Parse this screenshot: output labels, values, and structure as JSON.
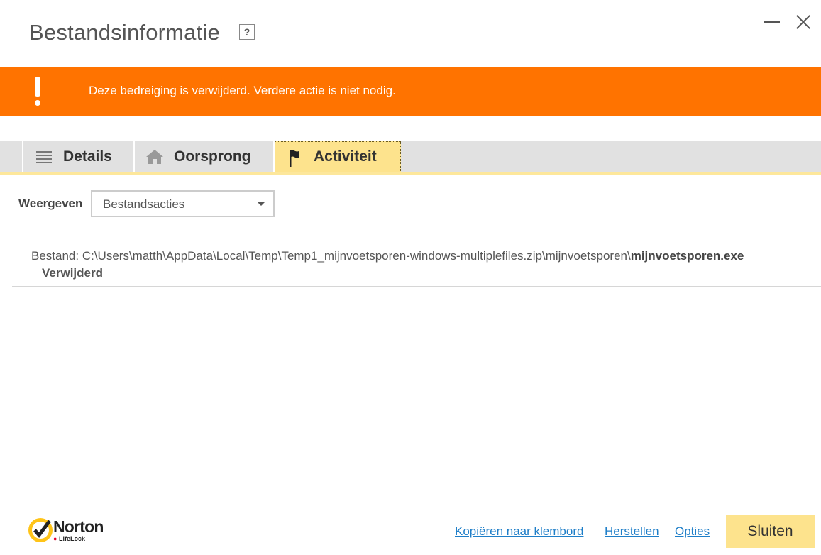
{
  "window": {
    "title": "Bestandsinformatie",
    "help_label": "?"
  },
  "alert": {
    "message": "Deze bedreiging is verwijderd. Verdere actie is niet nodig.",
    "color": "#ff7300"
  },
  "tabs": [
    {
      "label": "Details",
      "icon": "list-icon",
      "active": false
    },
    {
      "label": "Oorsprong",
      "icon": "home-icon",
      "active": false
    },
    {
      "label": "Activiteit",
      "icon": "flag-icon",
      "active": true
    }
  ],
  "filter": {
    "label": "Weergeven",
    "selected": "Bestandsacties"
  },
  "entries": [
    {
      "prefix": "Bestand: C:\\Users\\matth\\AppData\\Local\\Temp\\Temp1_mijnvoetsporen-windows-multiplefiles.zip\\mijnvoetsporen\\",
      "filename": "mijnvoetsporen.exe",
      "status": "Verwijderd"
    }
  ],
  "brand": {
    "name": "Norton",
    "sub_prefix": "",
    "sub": "LifeLock"
  },
  "footer": {
    "copy_link": "Kopiëren naar klembord",
    "restore_link": "Herstellen",
    "options_link": "Opties",
    "close_button": "Sluiten"
  },
  "colors": {
    "accent": "#fde38d",
    "link": "#1e7ec8"
  }
}
